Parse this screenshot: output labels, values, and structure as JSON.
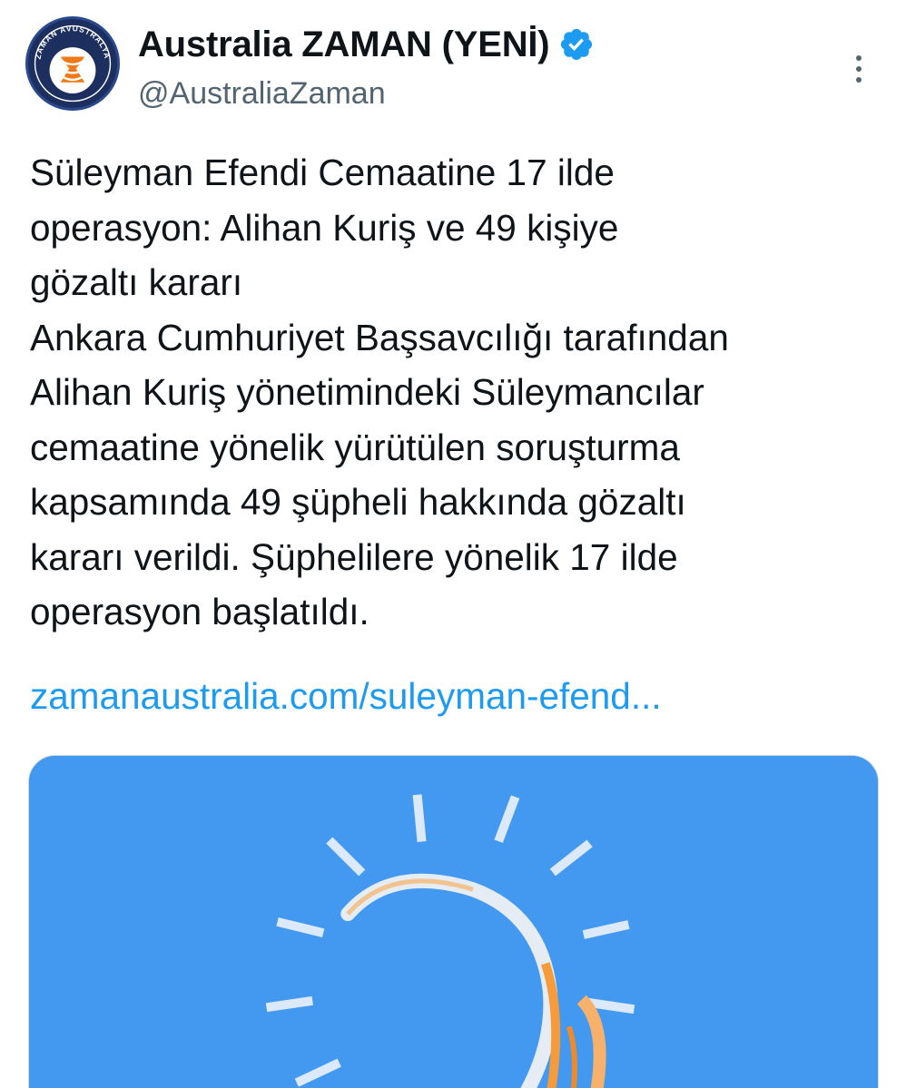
{
  "author": {
    "display_name": "Australia ZAMAN (YENİ)",
    "handle": "@AustraliaZaman",
    "avatar_text": "ZAMAN AVUSTRALYA",
    "verified": true
  },
  "tweet": {
    "text": "Süleyman Efendi Cemaatine 17 ilde\noperasyon: Alihan Kuriş ve 49 kişiye\ngözaltı kararı\nAnkara Cumhuriyet Başsavcılığı tarafından\nAlihan Kuriş yönetimindeki Süleymancılar\ncemaatine yönelik yürütülen soruşturma\nkapsamında 49 şüpheli hakkında gözaltı\nkararı verildi. Şüphelilere yönelik 17 ilde\noperasyon başlatıldı.",
    "link_text": "zamanaustralia.com/suleyman-efend..."
  },
  "colors": {
    "link": "#1d9bf0",
    "verified_badge": "#1d9bf0",
    "media_background": "#4399ef",
    "handle_gray": "#536471"
  },
  "icons": {
    "verified": "verified-badge-icon",
    "more": "more-vertical-icon"
  }
}
